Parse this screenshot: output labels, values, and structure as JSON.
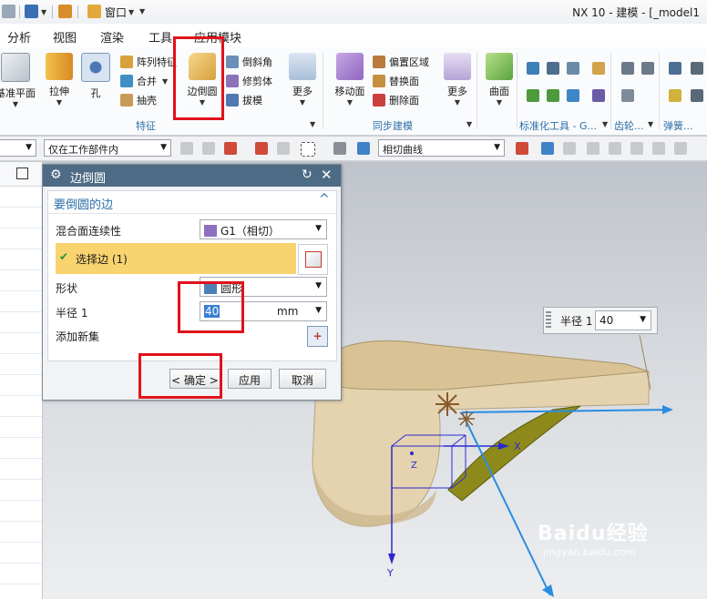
{
  "window": {
    "title": "NX 10 - 建模 - [_model1",
    "quick_access_window_label": "窗口"
  },
  "menu_tabs": [
    "分析",
    "视图",
    "渲染",
    "工具",
    "应用模块"
  ],
  "ribbon": {
    "buttons": {
      "datum_plane": "基准平面",
      "extrude": "拉伸",
      "hole": "孔",
      "pattern_feature": "阵列特征",
      "unite": "合并",
      "shell": "抽壳",
      "edge_blend": "边倒圆",
      "chamfer": "倒斜角",
      "trim_body": "修剪体",
      "draft": "拔模",
      "more_feature": "更多",
      "move_face": "移动面",
      "offset_region": "偏置区域",
      "replace_face": "替换面",
      "delete_face": "删除面",
      "more_sync": "更多",
      "surface": "曲面"
    },
    "groups": {
      "feature": "特征",
      "sync_modeling": "同步建模",
      "standard_tools": "标准化工具 - G...",
      "gear": "齿轮...",
      "spring": "弹簧..."
    }
  },
  "selection_bar": {
    "type_filter": "",
    "scope_filter": "仅在工作部件内",
    "curve_rule": "相切曲线"
  },
  "dialog": {
    "title": "边倒圆",
    "section_title": "要倒圆的边",
    "continuity_label": "混合面连续性",
    "continuity_value": "G1（相切）",
    "select_edge_label": "选择边 (1)",
    "shape_label": "形状",
    "shape_value": "圆形",
    "radius_label": "半径 1",
    "radius_value": "40",
    "radius_unit": "mm",
    "add_new_set_label": "添加新集",
    "ok_button": "< 确定 >",
    "apply_button": "应用",
    "cancel_button": "取消"
  },
  "radius_widget": {
    "label": "半径 1",
    "value": "40"
  },
  "viewport": {
    "axis_x": "X",
    "axis_y": "Y",
    "axis_z": "Z"
  },
  "watermark": {
    "logo": "Baidu经验",
    "url": "jingyan.baidu.com"
  },
  "colors": {
    "highlight_red": "#e0121b",
    "dialog_title_bg": "#4d6b85",
    "selected_row_bg": "#f9d36f",
    "solid_body": "#e3cfa6",
    "blend_face": "#8d8a1b",
    "dynamic_axis": "#2a8de0"
  }
}
